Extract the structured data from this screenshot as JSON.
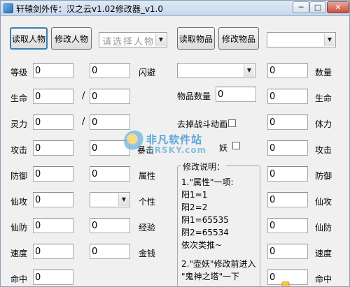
{
  "window": {
    "title": "轩辕剑外传：汉之云v1.02修改器_v1.0",
    "minimize": "─",
    "maximize": "□",
    "close": "✕"
  },
  "toolbar": {
    "read_character": "读取人物",
    "modify_character": "修改人物",
    "character_select_placeholder": "请选择人物",
    "read_item": "读取物品",
    "modify_item": "修改物品",
    "item_type_select": ""
  },
  "stats_left": {
    "level": {
      "label": "等级",
      "value": "0"
    },
    "hp": {
      "label": "生命",
      "value": "0",
      "max": "0",
      "sep": "/"
    },
    "mp": {
      "label": "灵力",
      "value": "0",
      "max": "0",
      "sep": "/"
    },
    "attack": {
      "label": "攻击",
      "value": "0"
    },
    "defense": {
      "label": "防御",
      "value": "0"
    },
    "immortal_attack": {
      "label": "仙攻",
      "value": "0"
    },
    "immortal_defense": {
      "label": "仙防",
      "value": "0"
    },
    "speed": {
      "label": "速度",
      "value": "0"
    },
    "hit": {
      "label": "命中",
      "value": "0"
    }
  },
  "stats_mid": {
    "evade": {
      "label": "闪避",
      "value": "0"
    },
    "burst": {
      "label": "暴击",
      "value": "0"
    },
    "attribute": {
      "label": "属性",
      "value": "0"
    },
    "personality": {
      "label": "个性",
      "value": ""
    },
    "experience": {
      "label": "经验",
      "value": "0"
    },
    "money": {
      "label": "金钱",
      "value": "0"
    }
  },
  "items": {
    "item_select": "",
    "item_count_label": "物品数量",
    "item_count": "0",
    "remove_battle_anim": "去掉战斗动画",
    "demon": "妖"
  },
  "stats_right": {
    "quantity": {
      "label": "数量",
      "value": "0"
    },
    "hp": {
      "label": "生命",
      "value": "0"
    },
    "stamina": {
      "label": "体力",
      "value": "0"
    },
    "attack": {
      "label": "攻击",
      "value": "0"
    },
    "defense": {
      "label": "防御",
      "value": "0"
    },
    "immortal_attack": {
      "label": "仙攻",
      "value": "0"
    },
    "immortal_defense": {
      "label": "仙防",
      "value": "0"
    },
    "speed": {
      "label": "速度",
      "value": "0"
    },
    "hit": {
      "label": "命中",
      "value": "0"
    }
  },
  "notes": {
    "title": "修改说明：",
    "lines": [
      "1.\"属性\"一项:",
      "阳1=1",
      "阳2=2",
      "阴1=65535",
      "阴2=65534",
      "依次类推~",
      "",
      "2.\"壶妖\"修改前进入",
      "\"鬼神之塔\"一下"
    ]
  },
  "watermark": {
    "cn": "非凡软件站",
    "en": "CRSKY.com"
  },
  "colors": {
    "focus_border": "#3c7fb1",
    "title_bar": "#c7d8ec",
    "window_bg": "#f0f0f0"
  }
}
